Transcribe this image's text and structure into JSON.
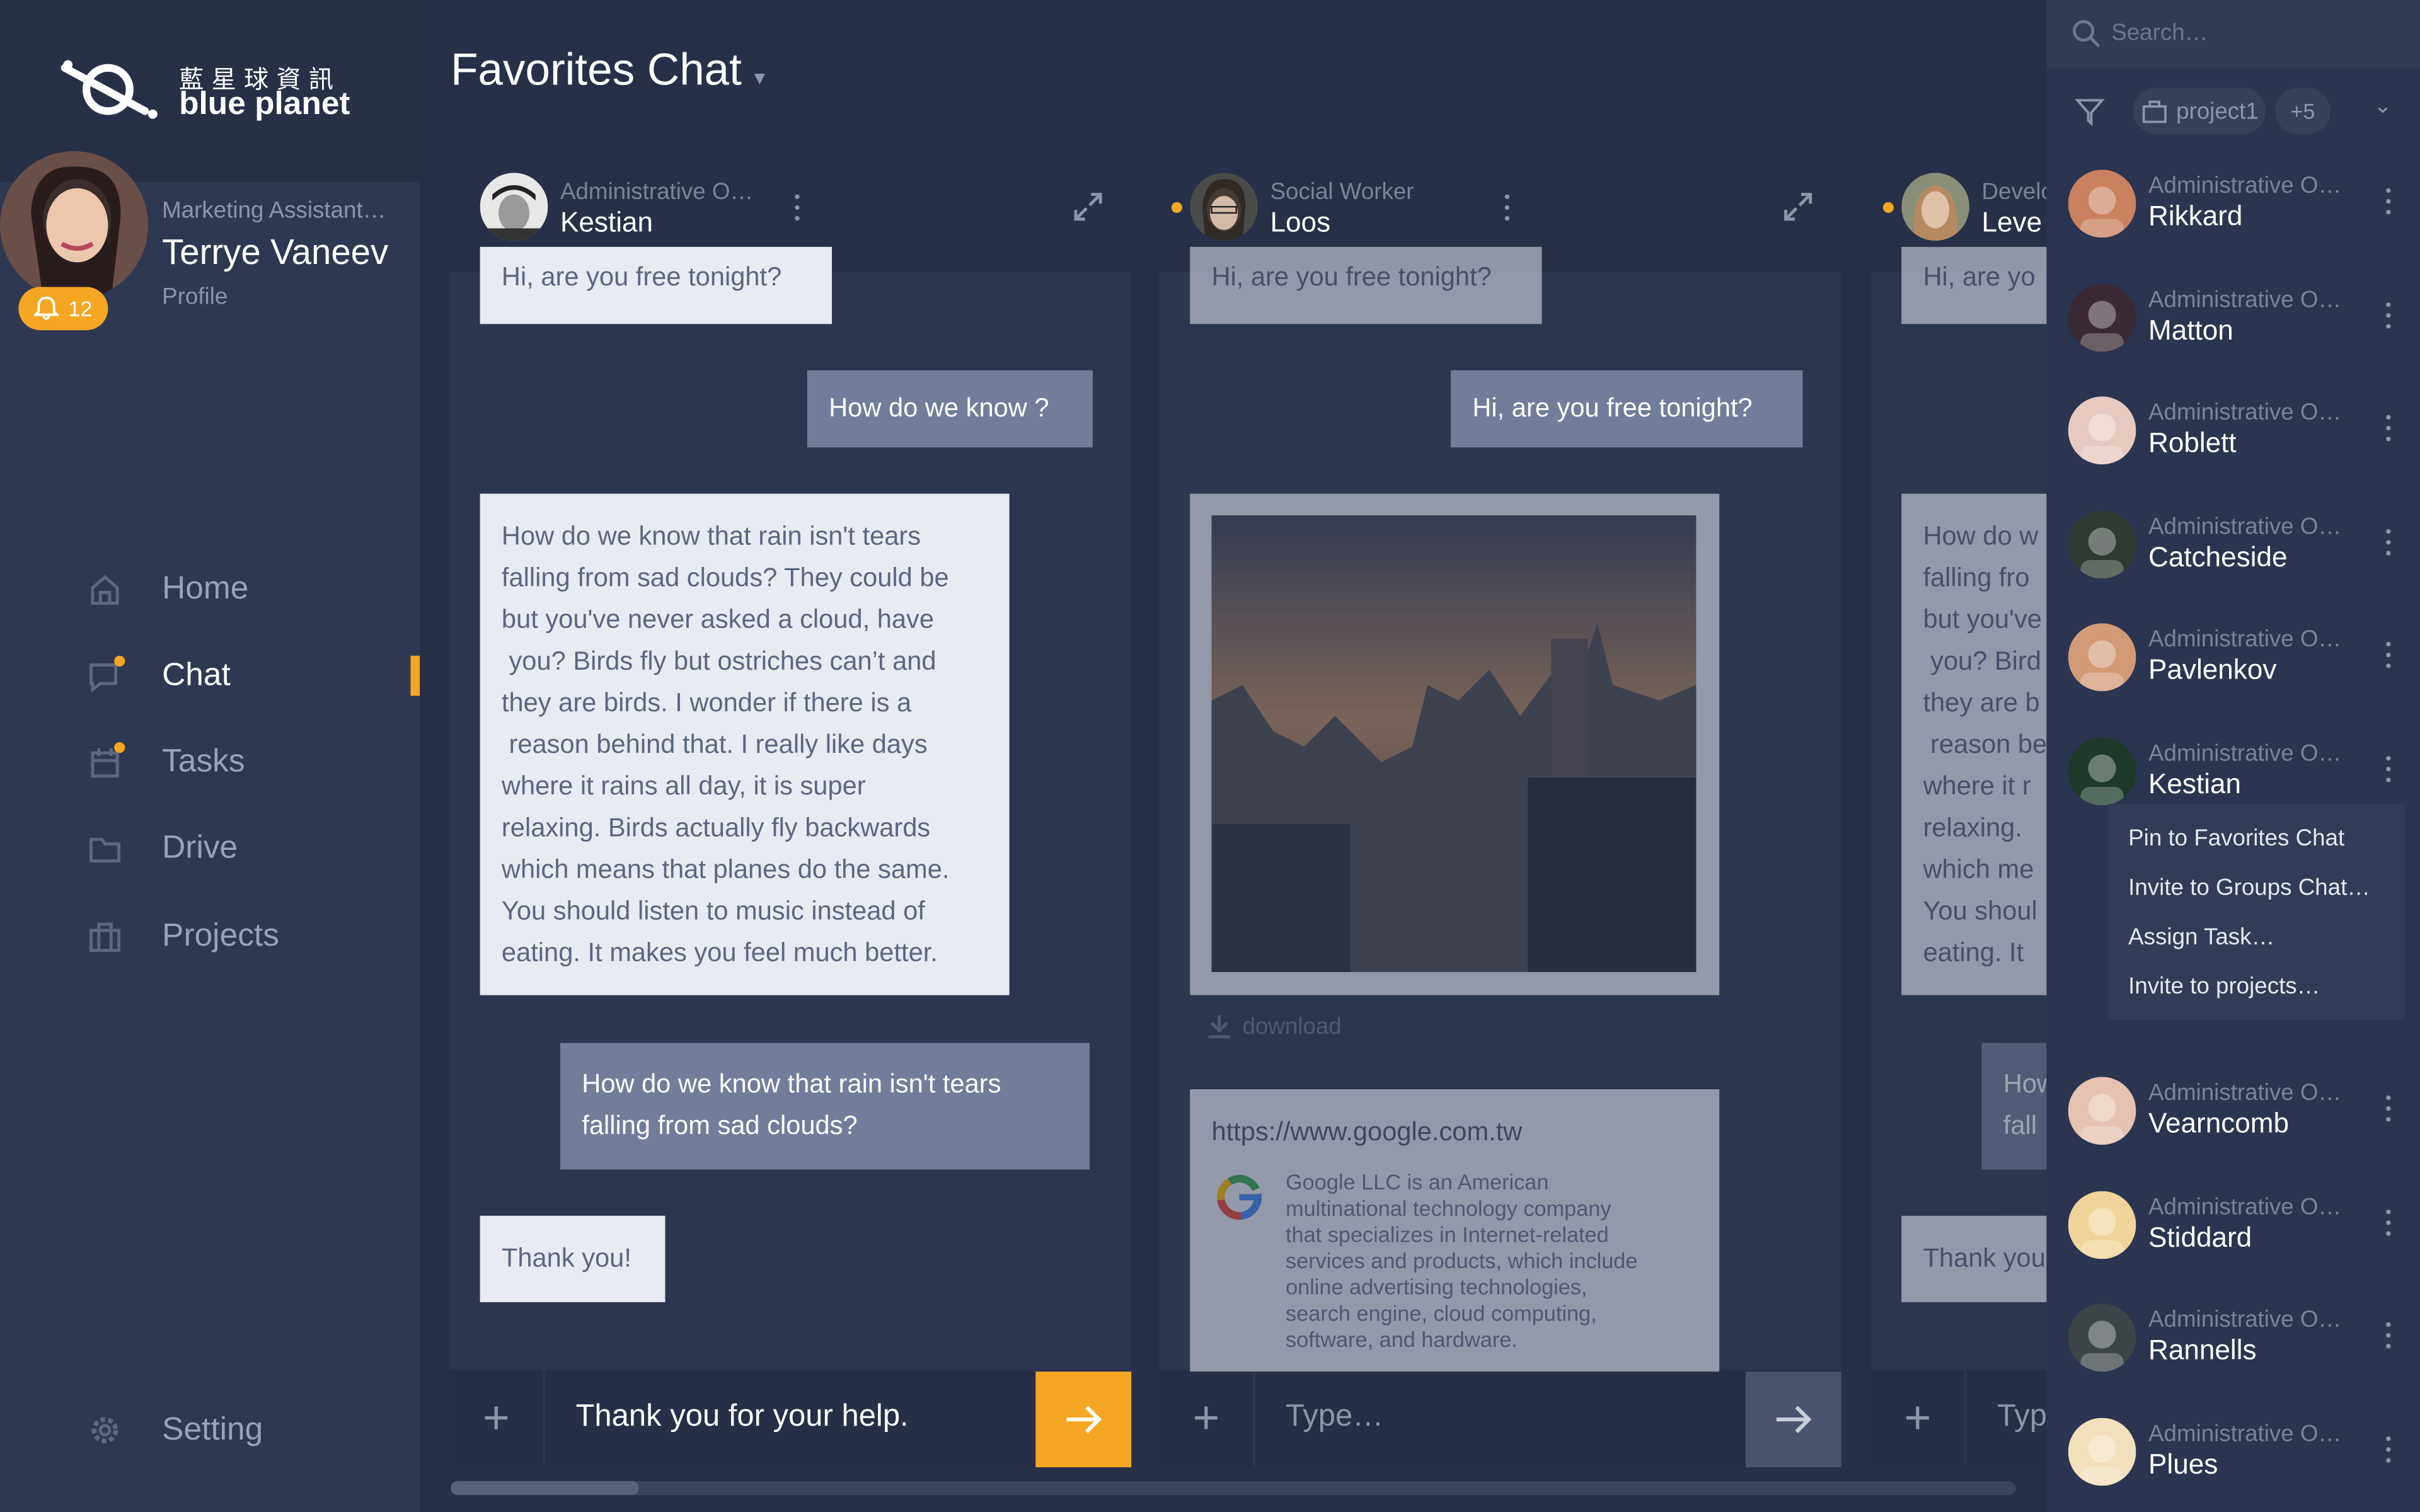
{
  "brand": {
    "cn": "藍星球資訊",
    "en": "blue planet"
  },
  "profile": {
    "role": "Marketing Assistant…",
    "name": "Terrye Vaneev",
    "link": "Profile",
    "notifications": "12"
  },
  "nav": [
    {
      "label": "Home",
      "icon": "home-icon"
    },
    {
      "label": "Chat",
      "icon": "chat-icon"
    },
    {
      "label": "Tasks",
      "icon": "calendar-icon"
    },
    {
      "label": "Drive",
      "icon": "folder-icon"
    },
    {
      "label": "Projects",
      "icon": "briefcase-icon"
    }
  ],
  "setting_label": "Setting",
  "page_title": "Favorites Chat",
  "chats": [
    {
      "role": "Administrative O…",
      "name": "Kestian",
      "messages": [
        "Hi, are you free tonight?",
        "How do we know ?",
        [
          "How do we know that rain isn't tears",
          "falling from sad clouds? They could be",
          "but you've never asked a cloud, have",
          " you? Birds fly but ostriches can’t and",
          "they are birds. I wonder if there is a",
          " reason behind that. I really like days",
          "where it rains all day, it is super",
          "relaxing. Birds actually fly backwards",
          "which means that planes do the same.",
          "You should listen to music instead of",
          "eating. It makes you feel much better."
        ],
        [
          "How do we know that rain isn't tears",
          "falling from sad clouds?"
        ],
        "Thank you!"
      ],
      "input_value": "Thank you for your help."
    },
    {
      "role": "Social Worker",
      "name": "Loos",
      "messages": [
        "Hi, are you free tonight?",
        "Hi, are you free tonight?"
      ],
      "download": "download",
      "link_url": "https://www.google.com.tw",
      "link_desc": [
        "Google LLC is an American",
        "multinational technology company",
        "that specializes in Internet-related",
        "services and products, which include",
        "online advertising technologies,",
        "search engine, cloud computing,",
        "software, and hardware."
      ],
      "input_placeholder": "Type…"
    },
    {
      "role": "Develo",
      "name": "Leve",
      "messages": [
        "Hi, are yo",
        [
          "How do w",
          "falling fro",
          "but you've",
          " you? Bird",
          "they are b",
          " reason be",
          "where it r",
          "relaxing.",
          "which me",
          "You shoul",
          "eating. It"
        ],
        [
          "How",
          "fall"
        ],
        "Thank you"
      ],
      "input_placeholder": "Typ"
    }
  ],
  "right_panel": {
    "search_placeholder": "Search…",
    "filter_chip": "project1",
    "filter_more": "+5",
    "contacts": [
      {
        "role": "Administrative O…",
        "name": "Rikkard"
      },
      {
        "role": "Administrative O…",
        "name": "Matton"
      },
      {
        "role": "Administrative O…",
        "name": "Roblett"
      },
      {
        "role": "Administrative O…",
        "name": "Catcheside"
      },
      {
        "role": "Administrative O…",
        "name": "Pavlenkov"
      },
      {
        "role": "Administrative O…",
        "name": "Kestian"
      },
      {
        "role": "Administrative O…",
        "name": "Vearncomb"
      },
      {
        "role": "Administrative O…",
        "name": "Stiddard"
      },
      {
        "role": "Administrative O…",
        "name": "Rannells"
      },
      {
        "role": "Administrative O…",
        "name": "Plues"
      }
    ],
    "context_menu": [
      "Pin to Favorites Chat",
      "Invite to Groups Chat…",
      "Assign Task…",
      "Invite to projects…"
    ]
  },
  "colors": {
    "accent": "#f5a623",
    "sidebar": "#2f3852",
    "background": "#273048"
  }
}
